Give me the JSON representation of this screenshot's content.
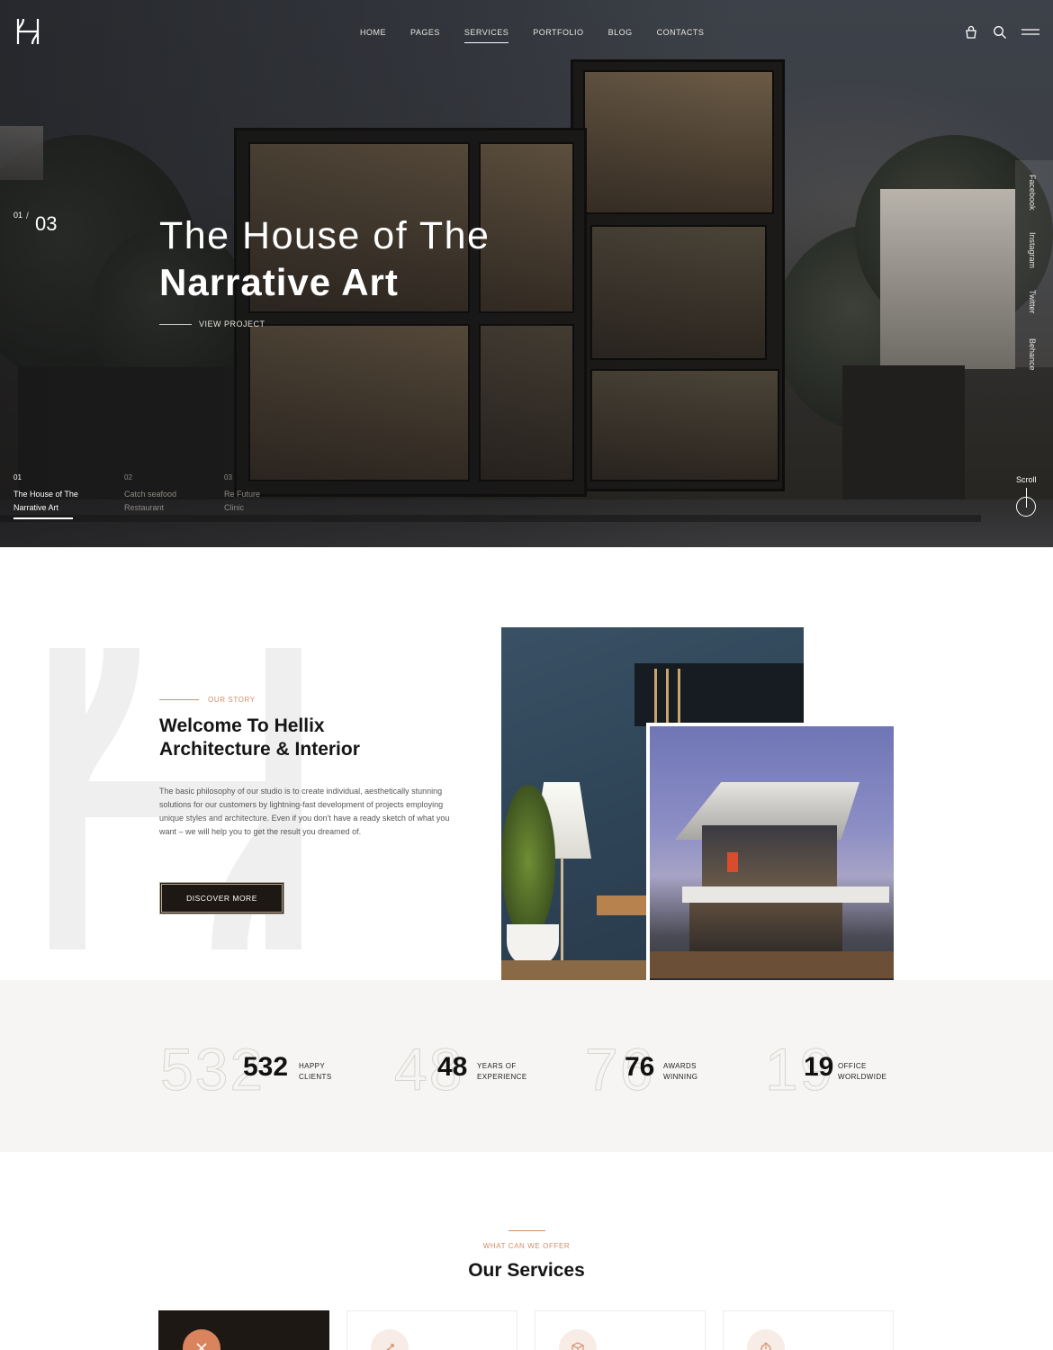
{
  "nav": {
    "items": [
      {
        "label": "HOME"
      },
      {
        "label": "PAGES"
      },
      {
        "label": "SERVICES"
      },
      {
        "label": "PORTFOLIO"
      },
      {
        "label": "BLOG"
      },
      {
        "label": "CONTACTS"
      }
    ],
    "active": "SERVICES"
  },
  "header_icons": [
    "cart-icon",
    "search-icon",
    "menu-icon"
  ],
  "hero": {
    "counter_current": "01",
    "counter_sep": "/",
    "counter_total": "03",
    "title_line1": "The House of The",
    "title_line2": "Narrative Art",
    "cta": "VIEW PROJECT",
    "social": [
      "Facebook",
      "Instagram",
      "Twitter",
      "Behance"
    ],
    "slides": [
      {
        "num": "01",
        "line1": "The House of The",
        "line2": "Narrative Art"
      },
      {
        "num": "02",
        "line1": "Catch seafood",
        "line2": "Restaurant"
      },
      {
        "num": "03",
        "line1": "Re Future",
        "line2": "Clinic"
      }
    ],
    "scroll_label": "Scroll"
  },
  "story": {
    "eyebrow": "OUR STORY",
    "title_line1": "Welcome To Hellix",
    "title_line2": "Architecture & Interior",
    "text": "The basic philosophy of our studio is to create individual, aesthetically stunning solutions for our customers by lightning-fast development of projects employing unique styles and architecture. Even if you don't have a ready sketch of what you want – we will help you to get the result you dreamed of.",
    "button": "DISCOVER MORE"
  },
  "stats": [
    {
      "value": "532",
      "line1": "HAPPY",
      "line2": "CLIENTS"
    },
    {
      "value": "48",
      "line1": "YEARS OF",
      "line2": "EXPERIENCE"
    },
    {
      "value": "76",
      "line1": "AWARDS",
      "line2": "WINNING"
    },
    {
      "value": "19",
      "line1": "OFFICE",
      "line2": "WORLDWIDE"
    }
  ],
  "services": {
    "eyebrow": "WHAT CAN WE OFFER",
    "title": "Our Services",
    "cards": [
      {
        "icon": "tools-icon"
      },
      {
        "icon": "rocket-icon"
      },
      {
        "icon": "cube-icon"
      },
      {
        "icon": "stopwatch-icon"
      }
    ]
  },
  "colors": {
    "accent": "#d28c65",
    "dark": "#1d1814",
    "stats_bg": "#f6f5f3"
  }
}
